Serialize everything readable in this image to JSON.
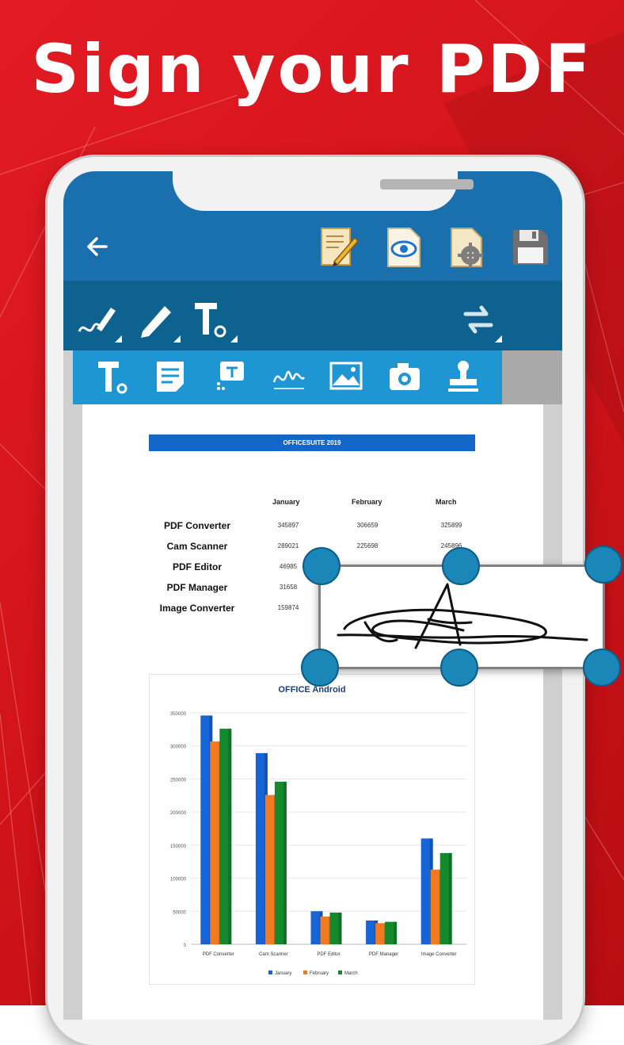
{
  "headline": "Sign your PDF",
  "top_toolbar": {
    "back": "back-arrow-icon",
    "icons": [
      "edit-document-icon",
      "view-document-icon",
      "document-settings-icon",
      "save-icon"
    ]
  },
  "annotate_toolbar": {
    "icons": [
      "signature-pen-icon",
      "pencil-icon",
      "text-tool-icon",
      "rotate-icon"
    ]
  },
  "insert_toolbar": {
    "icons": [
      "text-tool-icon",
      "note-icon",
      "text-comment-icon",
      "signature-icon",
      "image-icon",
      "camera-icon",
      "stamp-icon"
    ]
  },
  "document": {
    "title_bar": "OFFICESUITE 2019",
    "columns": [
      "January",
      "February",
      "March"
    ],
    "rows": [
      {
        "label": "PDF Converter",
        "values": [
          "345897",
          "306659",
          "325899"
        ]
      },
      {
        "label": "Cam Scanner",
        "values": [
          "289021",
          "225698",
          "245896"
        ]
      },
      {
        "label": "PDF Editor",
        "values": [
          "46985",
          "",
          ""
        ]
      },
      {
        "label": "PDF Manager",
        "values": [
          "31658",
          "",
          ""
        ]
      },
      {
        "label": "Image Converter",
        "values": [
          "159874",
          "",
          ""
        ]
      }
    ]
  },
  "chart_data": {
    "type": "bar",
    "title": "OFFICE Android",
    "categories": [
      "PDF Converter",
      "Cam Scanner",
      "PDF Editor",
      "PDF Manager",
      "Image Converter"
    ],
    "series": [
      {
        "name": "January",
        "color": "#1665d8",
        "values": [
          345897,
          289021,
          50000,
          36000,
          160000
        ]
      },
      {
        "name": "February",
        "color": "#f47a1f",
        "values": [
          306659,
          225698,
          42000,
          32000,
          113000
        ]
      },
      {
        "name": "March",
        "color": "#138a2e",
        "values": [
          325899,
          245896,
          48000,
          34000,
          138000
        ]
      }
    ],
    "y_ticks": [
      "0",
      "50000",
      "100000",
      "150000",
      "200000",
      "250000",
      "300000",
      "350000"
    ],
    "ylim": [
      0,
      350000
    ],
    "legend": "bottom",
    "grid": true
  },
  "signature": {
    "type": "handwritten-signature"
  }
}
